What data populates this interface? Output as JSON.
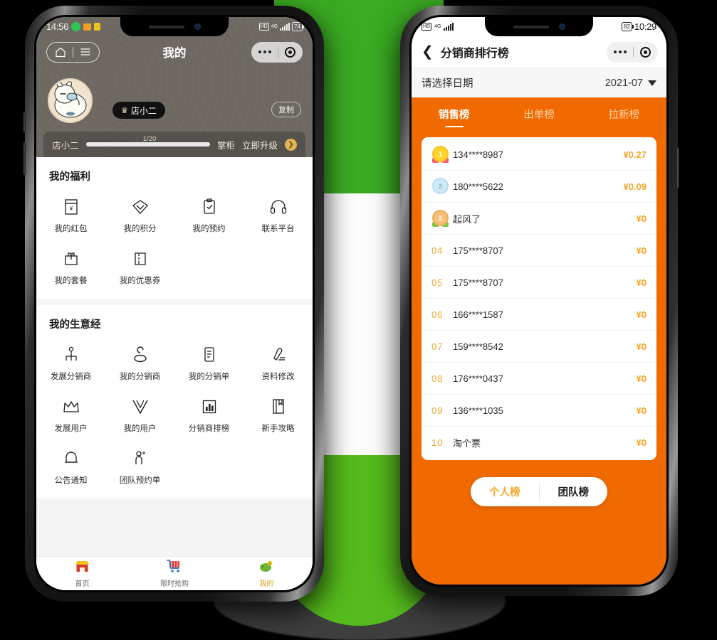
{
  "scene": {
    "background_color": "#000000",
    "accent_green": "#3aab22",
    "accent_green_light": "#55bb1c",
    "accent_orange": "#f16a00"
  },
  "left_phone": {
    "statusbar": {
      "time": "14:56",
      "battery": "74",
      "network": "4G",
      "hd_badge": "HD"
    },
    "navbar": {
      "title": "我的",
      "home_icon": "home-icon",
      "menu_icon": "menu-icon",
      "more_icon": "more-dots-icon",
      "target_icon": "target-icon"
    },
    "profile": {
      "avatar_icon": "alpaca-avatar",
      "badge_label": "店小二",
      "crown_icon": "crown-icon",
      "copy_label": "复制"
    },
    "level": {
      "name": "店小二",
      "progress_text": "1/20",
      "progress_percent": 5,
      "next_level": "掌柜",
      "upgrade_label": "立即升级",
      "arrow_icon": "chevron-right-icon"
    },
    "welfare": {
      "title": "我的福利",
      "items": [
        {
          "icon": "redpacket-icon",
          "label": "我的红包"
        },
        {
          "icon": "diamond-icon",
          "label": "我的积分"
        },
        {
          "icon": "clipboard-check-icon",
          "label": "我的预约"
        },
        {
          "icon": "headset-icon",
          "label": "联系平台"
        },
        {
          "icon": "package-icon",
          "label": "我的套餐"
        },
        {
          "icon": "coupon-icon",
          "label": "我的优惠券"
        }
      ]
    },
    "business": {
      "title": "我的生意经",
      "items": [
        {
          "icon": "network-person-icon",
          "label": "发展分销商"
        },
        {
          "icon": "user-stand-icon",
          "label": "我的分销商"
        },
        {
          "icon": "document-icon",
          "label": "我的分销单"
        },
        {
          "icon": "pencil-edit-icon",
          "label": "资料修改"
        },
        {
          "icon": "crown-outline-icon",
          "label": "发展用户"
        },
        {
          "icon": "vip-v-icon",
          "label": "我的用户"
        },
        {
          "icon": "bar-chart-icon",
          "label": "分销商排榜"
        },
        {
          "icon": "book-icon",
          "label": "新手攻略"
        },
        {
          "icon": "bell-icon",
          "label": "公告通知"
        },
        {
          "icon": "person-icon",
          "label": "团队预约单"
        }
      ]
    },
    "tabbar": [
      {
        "icon": "shop-icon",
        "label": "首页",
        "active": false
      },
      {
        "icon": "cart-icon",
        "label": "限时抢购",
        "active": false
      },
      {
        "icon": "wallet-icon",
        "label": "我的",
        "active": true
      }
    ]
  },
  "right_phone": {
    "statusbar": {
      "time": "10:29",
      "battery": "82",
      "network": "4G",
      "hd_badge": "HD"
    },
    "navbar": {
      "back_icon": "chevron-left-icon",
      "title": "分销商排行榜",
      "more_icon": "more-dots-icon",
      "target_icon": "target-icon"
    },
    "date_selector": {
      "label": "请选择日期",
      "value": "2021-07",
      "caret_icon": "caret-down-icon"
    },
    "tabs": [
      {
        "label": "销售榜",
        "active": true
      },
      {
        "label": "出单榜",
        "active": false
      },
      {
        "label": "拉新榜",
        "active": false
      }
    ],
    "ranking": [
      {
        "rank": "1",
        "medal": "gold",
        "name": "134****8987",
        "value": "¥0.27"
      },
      {
        "rank": "2",
        "medal": "silver",
        "name": "180****5622",
        "value": "¥0.09"
      },
      {
        "rank": "3",
        "medal": "bronze",
        "name": "起风了",
        "value": "¥0"
      },
      {
        "rank": "04",
        "medal": "",
        "name": "175****8707",
        "value": "¥0"
      },
      {
        "rank": "05",
        "medal": "",
        "name": "175****8707",
        "value": "¥0"
      },
      {
        "rank": "06",
        "medal": "",
        "name": "166****1587",
        "value": "¥0"
      },
      {
        "rank": "07",
        "medal": "",
        "name": "159****8542",
        "value": "¥0"
      },
      {
        "rank": "08",
        "medal": "",
        "name": "176****0437",
        "value": "¥0"
      },
      {
        "rank": "09",
        "medal": "",
        "name": "136****1035",
        "value": "¥0"
      },
      {
        "rank": "10",
        "medal": "",
        "name": "淘个票",
        "value": "¥0"
      }
    ],
    "bottom_toggle": [
      {
        "label": "个人榜",
        "active": true
      },
      {
        "label": "团队榜",
        "active": false
      }
    ]
  }
}
